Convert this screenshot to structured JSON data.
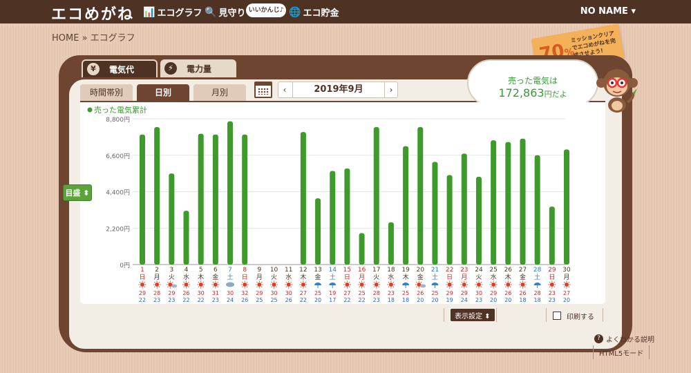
{
  "app": {
    "logo": "エコめがね",
    "nav": [
      {
        "label": "エコグラフ",
        "icon": "bar-chart-icon"
      },
      {
        "label": "見守り",
        "icon": "magnifier-icon"
      },
      {
        "label": "エコ貯金",
        "icon": "coin-icon"
      }
    ],
    "bubble": "いいかんじ♪",
    "user": "NO NAME ▾"
  },
  "breadcrumb": "HOME » エコグラフ",
  "mission": {
    "percent": "70",
    "unit": "%",
    "text": "ミッションクリアでエコめがねを完成させよう!"
  },
  "tabs": {
    "main": [
      {
        "label": "電気代",
        "icon": "¥"
      },
      {
        "label": "電力量",
        "icon": "⚡"
      }
    ],
    "sub": [
      "時間帯別",
      "日別",
      "月別"
    ]
  },
  "date_nav": {
    "prev": "‹",
    "label": "2019年9月",
    "next": "›"
  },
  "sold": {
    "title": "売った電気は",
    "value": "172,863",
    "unit": "円だよ"
  },
  "target_btn": "目盛 ⬍",
  "bottom": {
    "display_setting": "表示設定 ⬍",
    "print": "印刷する",
    "help": "よくわかる説明",
    "html5": "HTML5モード"
  },
  "colors": {
    "bar": "#3d9a2b",
    "sunday": "#d9221f",
    "saturday": "#2a7bd6",
    "weekday": "#4a3526",
    "hi": "#d9221f",
    "lo": "#2a5fd6"
  },
  "chart_data": {
    "type": "bar",
    "legend": "売った電気累計",
    "ylim": [
      0,
      8800
    ],
    "yticks": [
      "0円",
      "2,200円",
      "4,400円",
      "6,600円",
      "8,800円"
    ],
    "grid": true,
    "categories": [
      "1",
      "2",
      "3",
      "4",
      "5",
      "6",
      "7",
      "8",
      "9",
      "10",
      "11",
      "12",
      "13",
      "14",
      "15",
      "16",
      "17",
      "18",
      "19",
      "20",
      "21",
      "22",
      "23",
      "24",
      "25",
      "26",
      "27",
      "28",
      "29",
      "30"
    ],
    "weekdays": [
      "日",
      "月",
      "火",
      "水",
      "木",
      "金",
      "土",
      "日",
      "月",
      "火",
      "水",
      "木",
      "金",
      "土",
      "日",
      "月",
      "火",
      "水",
      "木",
      "金",
      "土",
      "日",
      "月",
      "火",
      "水",
      "木",
      "金",
      "土",
      "日",
      "月"
    ],
    "day_types": [
      "sun",
      "wd",
      "wd",
      "wd",
      "wd",
      "wd",
      "sat",
      "sun",
      "wd",
      "wd",
      "wd",
      "wd",
      "wd",
      "sat",
      "sun",
      "sun",
      "wd",
      "wd",
      "wd",
      "wd",
      "sat",
      "sun",
      "sun",
      "wd",
      "wd",
      "wd",
      "wd",
      "sat",
      "sun",
      "wd"
    ],
    "values": [
      7850,
      8300,
      5500,
      3250,
      7900,
      7850,
      8650,
      7850,
      0,
      0,
      0,
      8000,
      4000,
      5650,
      5800,
      1900,
      8300,
      2550,
      7150,
      8300,
      6200,
      5400,
      6700,
      5300,
      7500,
      7400,
      7600,
      6600,
      3500,
      6950
    ],
    "weather": [
      "sun",
      "sun",
      "sun-cloud",
      "sun",
      "sun",
      "sun",
      "cloud",
      "sun",
      "sun",
      "sun",
      "sun",
      "sun",
      "rain",
      "rain",
      "sun",
      "sun",
      "sun",
      "sun",
      "rain",
      "sun-cloud",
      "rain",
      "sun",
      "sun",
      "sun",
      "sun",
      "sun",
      "sun",
      "rain",
      "sun",
      "sun"
    ],
    "temp_high": [
      "29",
      "28",
      "29",
      "26",
      "30",
      "31",
      "30",
      "32",
      "29",
      "30",
      "30",
      "27",
      "25",
      "19",
      "27",
      "25",
      "28",
      "23",
      "25",
      "26",
      "25",
      "29",
      "29",
      "30",
      "29",
      "26",
      "26",
      "28",
      "23",
      "27"
    ],
    "temp_low": [
      "22",
      "23",
      "23",
      "22",
      "22",
      "23",
      "24",
      "26",
      "25",
      "25",
      "26",
      "22",
      "20",
      "17",
      "22",
      "22",
      "23",
      "18",
      "18",
      "20",
      "20",
      "19",
      "24",
      "23",
      "20",
      "20",
      "18",
      "18",
      "23",
      "20"
    ]
  }
}
